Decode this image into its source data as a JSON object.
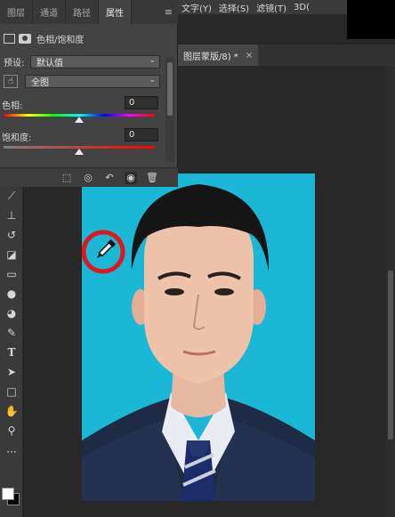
{
  "menubar": {
    "items": [
      "文字(Y)",
      "选择(S)",
      "滤镜(T)",
      "3D("
    ]
  },
  "document": {
    "tab_label": "图层蒙版/8) *",
    "close_glyph": "×"
  },
  "panel": {
    "tabs": [
      "图层",
      "通道",
      "路径",
      "属性"
    ],
    "active_tab": "属性",
    "menu_glyph": "≡",
    "adjustment_title": "色相/饱和度",
    "preset_label": "预设:",
    "preset_value": "默认值",
    "channel_value": "全图",
    "hue_label": "色相:",
    "hue_value": "0",
    "saturation_label": "饱和度:",
    "saturation_value": "0",
    "hue_slider_level": 0.5,
    "saturation_slider_level": 0.5
  },
  "footer_buttons": [
    "clip-to-layer-icon",
    "view-previous-state-icon",
    "reset-icon",
    "visibility-eye-icon",
    "trash-icon"
  ],
  "toolbar_tools": [
    "brush-icon",
    "clone-stamp-icon",
    "history-brush-icon",
    "eraser-icon",
    "gradient-icon",
    "blur-icon",
    "dodge-icon",
    "pen-icon",
    "type-icon",
    "path-select-icon",
    "rectangle-icon",
    "hand-icon",
    "zoom-icon",
    "more-tools-icon"
  ],
  "toolbar_type_glyph": "T",
  "colors": {
    "photo_background": "#1ab7d6",
    "highlight_circle": "#e0161c",
    "panel_bg": "#434343"
  }
}
